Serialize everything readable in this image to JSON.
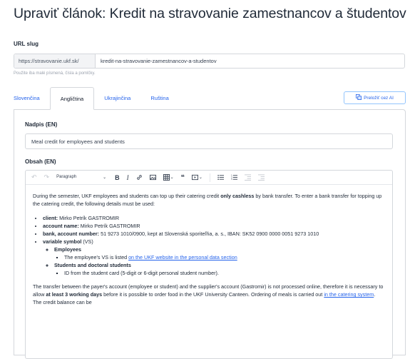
{
  "page": {
    "title": "Upraviť článok: Kredit na stravovanie zamestnancov a študentov"
  },
  "slug": {
    "label": "URL slug",
    "prefix": "https://stravovanie.ukf.sk/",
    "value": "kredit-na-stravovanie-zamestnancov-a-studentov",
    "help": "Použite iba malé písmená, čísla a pomlčky."
  },
  "tabs": [
    {
      "label": "Slovenčina",
      "active": false
    },
    {
      "label": "Angličtina",
      "active": true
    },
    {
      "label": "Ukrajinčina",
      "active": false
    },
    {
      "label": "Ruština",
      "active": false
    }
  ],
  "translate_button": {
    "label": "Preložiť cez AI",
    "icon": "translate-icon"
  },
  "form": {
    "title_label": "Nadpis (EN)",
    "title_value": "Meal credit for employees and students",
    "content_label": "Obsah (EN)"
  },
  "toolbar": {
    "paragraph_select": "Paragraph",
    "icons": [
      "undo-icon",
      "redo-icon",
      "bold-icon",
      "italic-icon",
      "link-icon",
      "image-icon",
      "table-icon",
      "quote-icon",
      "media-icon",
      "bulleted-list-icon",
      "numbered-list-icon",
      "outdent-icon",
      "indent-icon"
    ]
  },
  "content": {
    "intro_before_bold": "During the semester, UKF employees and students can top up their catering credit ",
    "intro_bold": "only cashless",
    "intro_after_bold": " by bank transfer. To enter a bank transfer for topping up the catering credit, the following details must be used:",
    "client_label": "client:",
    "client_value": " Mirko Petrík GASTROMIR",
    "account_name_label": "account name:",
    "account_name_value": " Mirko Petrík GASTROMIR",
    "bank_label": "bank, account number:",
    "bank_value": " 51 9273 1010/0900, kept at Slovenská sporiteľňa, a. s., IBAN: SK52 0900 0000 0051 9273 1010",
    "vs_label": "variable symbol",
    "vs_value": " (VS)",
    "employees_label": "Employees",
    "employees_text": "The employee's VS is listed ",
    "employees_link": "on the UKF website in the personal data section",
    "students_label": "Students and doctoral students",
    "students_text": "ID from the student card (5-digit or 6-digit personal student number).",
    "transfer_text_1": "The transfer between the payer's account (employee or student) and the supplier's account (Gastromir) is not processed online, therefore it is necessary to allow ",
    "transfer_bold": "at least 3 working days",
    "transfer_text_2": " before it is possible to order food in the UKF University Canteen. Ordering of meals is carried out ",
    "transfer_link": "in the catering system",
    "transfer_text_3": ". The credit balance can be"
  }
}
